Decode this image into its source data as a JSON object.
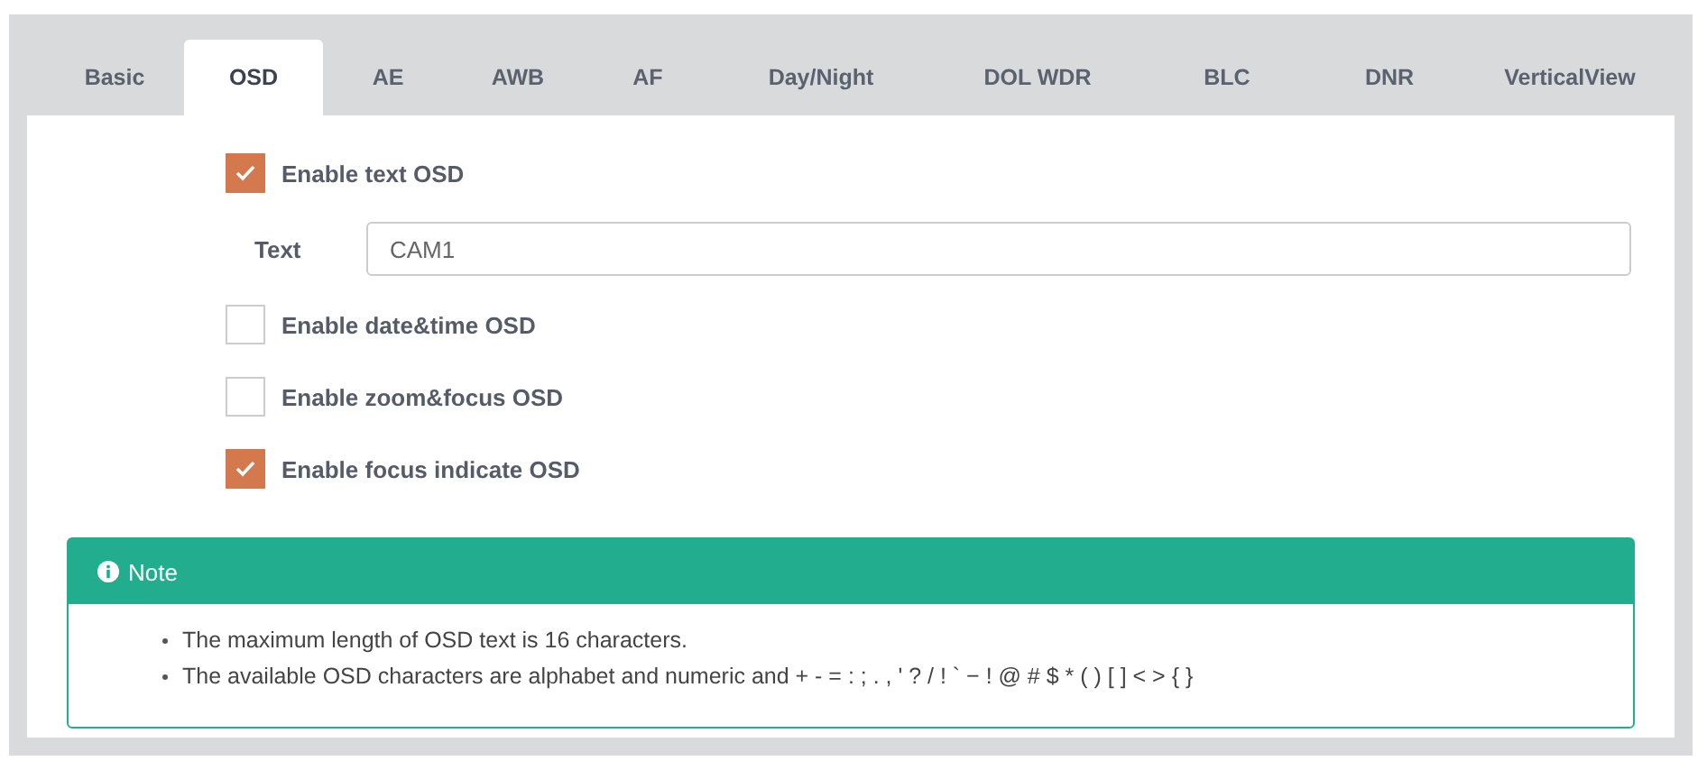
{
  "tabs": [
    {
      "label": "Basic",
      "selected": false
    },
    {
      "label": "OSD",
      "selected": true
    },
    {
      "label": "AE",
      "selected": false
    },
    {
      "label": "AWB",
      "selected": false
    },
    {
      "label": "AF",
      "selected": false
    },
    {
      "label": "Day/Night",
      "selected": false
    },
    {
      "label": "DOL WDR",
      "selected": false
    },
    {
      "label": "BLC",
      "selected": false
    },
    {
      "label": "DNR",
      "selected": false
    },
    {
      "label": "VerticalView",
      "selected": false
    }
  ],
  "options": [
    {
      "kind": "checkbox",
      "label": "Enable text OSD",
      "checked": true
    },
    {
      "kind": "text_field",
      "label": "Text",
      "value": "CAM1"
    },
    {
      "kind": "checkbox",
      "label": "Enable date&time OSD",
      "checked": false
    },
    {
      "kind": "checkbox",
      "label": "Enable zoom&focus OSD",
      "checked": false
    },
    {
      "kind": "checkbox",
      "label": "Enable focus indicate OSD",
      "checked": true
    }
  ],
  "note": {
    "title": "Note",
    "items": [
      "The maximum length of OSD text is 16 characters.",
      "The available OSD characters are alphabet and numeric and + - = : ; . , ' ? / ! ` − ! @ # $ * ( ) [ ] < > { }"
    ]
  }
}
